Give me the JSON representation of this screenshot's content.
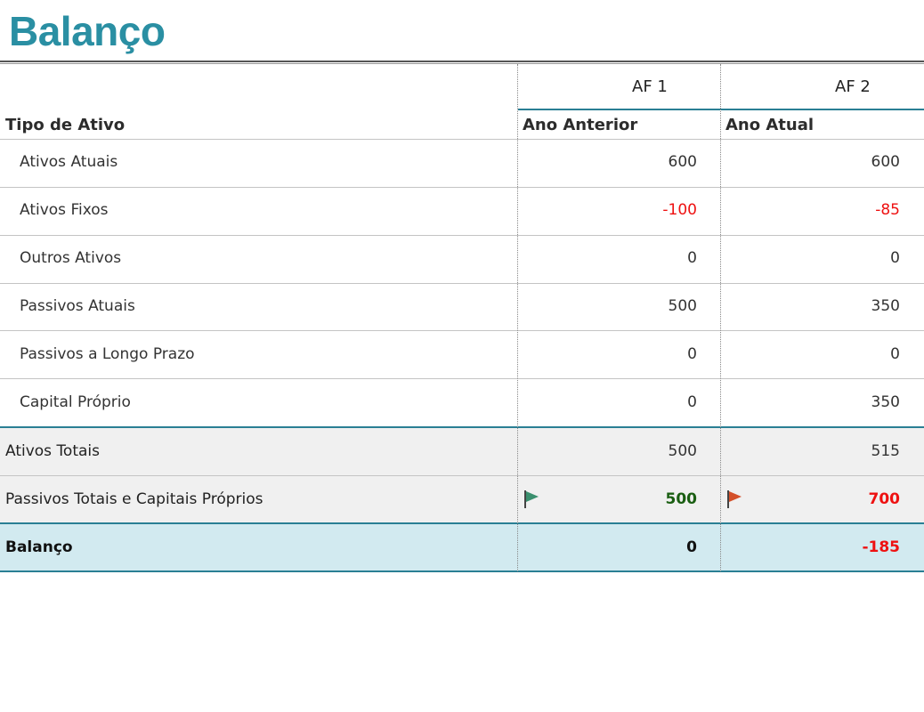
{
  "title": "Balanço",
  "columns": {
    "label_header": "Tipo de Ativo",
    "col1": {
      "period": "AF 1",
      "label": "Ano Anterior"
    },
    "col2": {
      "period": "AF 2",
      "label": "Ano Atual"
    }
  },
  "rows": [
    {
      "label": "Ativos Atuais",
      "v1": "600",
      "v2": "600"
    },
    {
      "label": "Ativos Fixos",
      "v1": "-100",
      "v2": "-85"
    },
    {
      "label": "Outros Ativos",
      "v1": "0",
      "v2": "0"
    },
    {
      "label": "Passivos Atuais",
      "v1": "500",
      "v2": "350"
    },
    {
      "label": "Passivos a Longo Prazo",
      "v1": "0",
      "v2": "0"
    },
    {
      "label": "Capital Próprio",
      "v1": "0",
      "v2": "350"
    }
  ],
  "totals": [
    {
      "label": "Ativos Totais",
      "v1": "500",
      "v2": "515"
    },
    {
      "label": "Passivos Totais e Capitais Próprios",
      "v1": "500",
      "v2": "700",
      "flag1": "green-flag-icon",
      "flag2": "red-flag-icon"
    }
  ],
  "balance": {
    "label": "Balanço",
    "v1": "0",
    "v2": "-185"
  },
  "colors": {
    "accent": "#2a8fa3",
    "negative": "#ee1111",
    "positive": "#1a5e12",
    "total_band": "#f0f0f0",
    "balance_band": "#d2eaf0"
  }
}
